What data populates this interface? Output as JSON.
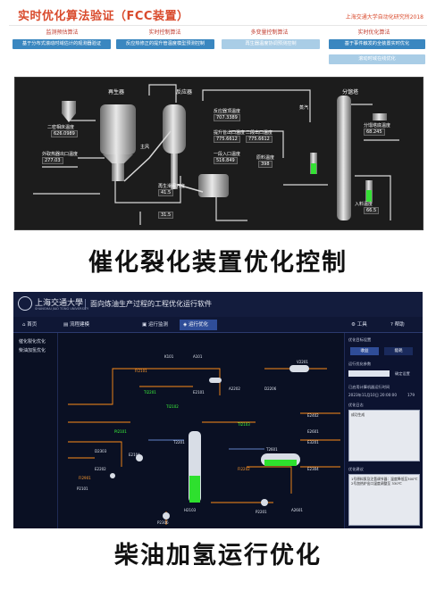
{
  "fcc": {
    "title": "实时优化算法验证（FCC装置）",
    "org": "上海交通大学自动化研究所2018",
    "sections": [
      {
        "title": "监测预估算法",
        "button": "基于分布式滚动时域估计的观测器验证"
      },
      {
        "title": "实时控制算法",
        "button": "反应热修正的提升管温度模型预测控制"
      },
      {
        "title": "多变量控制算法",
        "button": "再生器温度协调预测控制"
      },
      {
        "title": "实时优化算法",
        "button": "基于事件触发的全装置实时优化",
        "button2": "滚动时域在线优化"
      }
    ],
    "units": {
      "regenerator": "再生器",
      "reactor": "反应器",
      "fractionator": "分馏塔"
    },
    "labels": {
      "flue_gas": "烟气",
      "regen_temp": "二密相床温度",
      "regen_val": "626.0989",
      "reg_exit": "出口温度",
      "reg_exit_val": "626.0989",
      "main_air": "主风",
      "outer_steam": "外取热器出口温度",
      "outer_steam_val": "277.03",
      "reactor_val": "707.3389",
      "reactor_top": "反应器顶温度",
      "riser_out": "提升管出口温度",
      "riser_val": "775.6612",
      "riser2": "二段出口温度",
      "riser2_val": "775.6612",
      "riser3": "一段入口温度",
      "riser3_val": "516.849",
      "feed_temp": "原料温度",
      "feed_val": "398",
      "regen_slide": "再生滑阀开度",
      "regen_slide_val": "41.5",
      "reg_ratio": "剂油比",
      "reg_ratio_val": "31.5",
      "steam": "蒸汽",
      "bottom": "分馏塔底温度",
      "bottom_val": "68.245",
      "top_temp": "顶部温度",
      "feed_in": "入料温度",
      "feed_in_val": "66.5",
      "out_temp": "产品出口温度"
    }
  },
  "caption_fcc": "催化裂化装置优化控制",
  "diesel": {
    "logo_text": "上海交通大學",
    "logo_sub": "SHANGHAI JIAO TONG UNIVERSITY",
    "app_title": "面向炼油生产过程的工程优化运行软件",
    "tools": {
      "tool": "工具",
      "help": "帮助"
    },
    "tabs": [
      "首页",
      "流程建模",
      "运行监测",
      "运行优化"
    ],
    "active_tab": 3,
    "side_items": [
      "催化裂化优化",
      "柴油加氢优化"
    ],
    "right_panel": {
      "opt_label": "优化目标设置",
      "btn1": "收益",
      "btn2": "能耗",
      "weight_label": "运行优化参数",
      "apply_btn": "确定设置",
      "time_label": "已启用计算机器运行时间",
      "time_value": "2023年11月10日 20:00:00",
      "time_count": "179",
      "log_label": "优化日志",
      "log_text": "成功生成",
      "result_label": "优化建议",
      "result_text": "1号原料泵及注氢调节器：温度降低至300℃ 2号加热炉出口温度调整至 330℃"
    },
    "flow_labels": [
      {
        "t": "K101",
        "c": "w"
      },
      {
        "t": "A101",
        "c": "w"
      },
      {
        "t": "E2101",
        "c": "w"
      },
      {
        "t": "FI2101",
        "c": "o"
      },
      {
        "t": "TI2201",
        "c": "g"
      },
      {
        "t": "TI2102",
        "c": "g"
      },
      {
        "t": "PI2101",
        "c": "g"
      },
      {
        "t": "E2104",
        "c": "w"
      },
      {
        "t": "T2201",
        "c": "w"
      },
      {
        "t": "A2202",
        "c": "w"
      },
      {
        "t": "D2206",
        "c": "w"
      },
      {
        "t": "V2201",
        "c": "w"
      },
      {
        "t": "TI2103",
        "c": "g"
      },
      {
        "t": "FI2202",
        "c": "o"
      },
      {
        "t": "H2103",
        "c": "w"
      },
      {
        "t": "P2306",
        "c": "w"
      },
      {
        "t": "P2201",
        "c": "w"
      },
      {
        "t": "D2303",
        "c": "w"
      },
      {
        "t": "E2202",
        "c": "w"
      },
      {
        "t": "E3201",
        "c": "w"
      },
      {
        "t": "P2101",
        "c": "w"
      },
      {
        "t": "FI2901",
        "c": "o"
      },
      {
        "t": "E2304",
        "c": "w"
      },
      {
        "t": "T2601",
        "c": "w"
      },
      {
        "t": "A2601",
        "c": "w"
      },
      {
        "t": "E2402",
        "c": "w"
      },
      {
        "t": "E2601",
        "c": "w"
      }
    ]
  },
  "caption_diesel": "柴油加氢运行优化"
}
